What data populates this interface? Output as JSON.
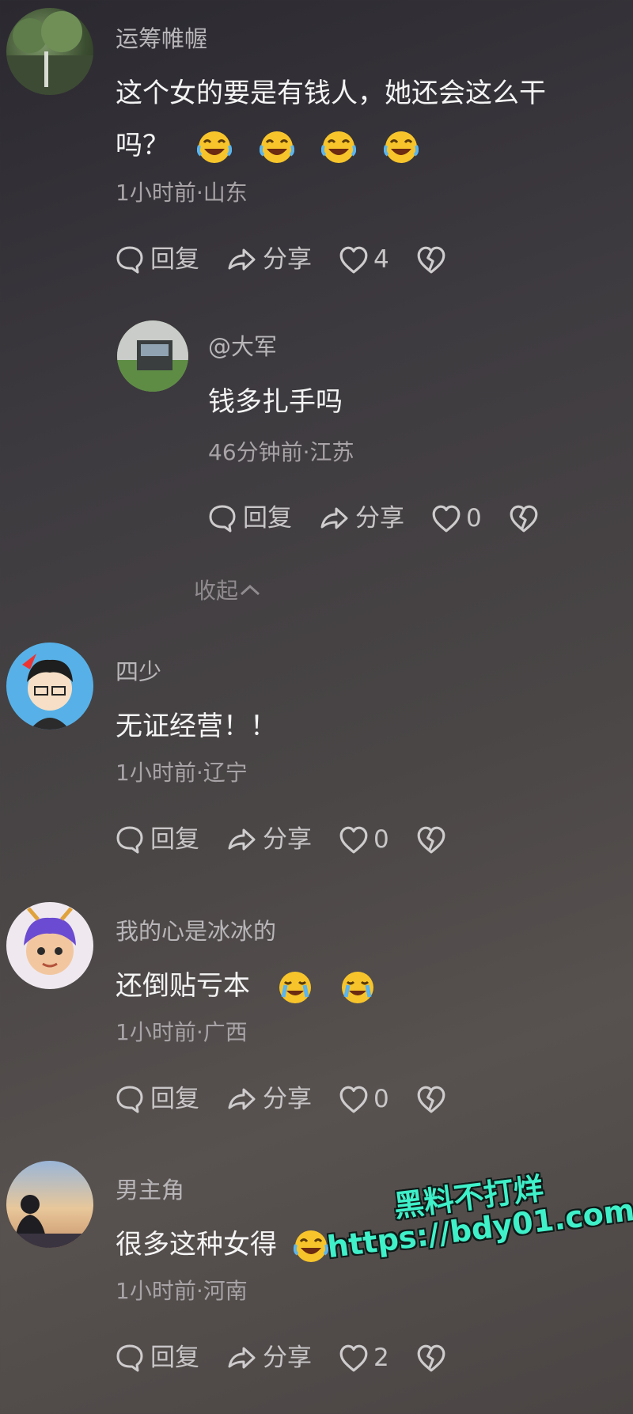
{
  "comments": [
    {
      "username": "运筹帷幄",
      "text_line1": "这个女的要是有钱人，她还会这么干",
      "text_line2": "吗？",
      "meta": "1小时前·山东",
      "reply": "回复",
      "share": "分享",
      "likes": "4"
    },
    {
      "username": "@大军",
      "text_line1": "钱多扎手吗",
      "meta": "46分钟前·江苏",
      "reply": "回复",
      "share": "分享",
      "likes": "0"
    },
    {
      "username": "四少",
      "text_line1": "无证经营！！",
      "meta": "1小时前·辽宁",
      "reply": "回复",
      "share": "分享",
      "likes": "0"
    },
    {
      "username": "我的心是冰冰的",
      "text_line1": "还倒贴亏本",
      "meta": "1小时前·广西",
      "reply": "回复",
      "share": "分享",
      "likes": "0"
    },
    {
      "username": "男主角",
      "text_line1": "很多这种女得",
      "meta": "1小时前·河南",
      "reply": "回复",
      "share": "分享",
      "likes": "2"
    }
  ],
  "collapse_label": "收起",
  "watermark": {
    "line1": "黑料不打烊",
    "line2": "https://bdy01.com"
  },
  "colors": {
    "accent_watermark": "#3ff0c9",
    "background": "#3e3b40"
  },
  "icons": [
    "comment-icon",
    "share-arrow-icon",
    "heart-icon",
    "broken-heart-icon",
    "laughing-emoji",
    "crying-laughing-emoji"
  ]
}
